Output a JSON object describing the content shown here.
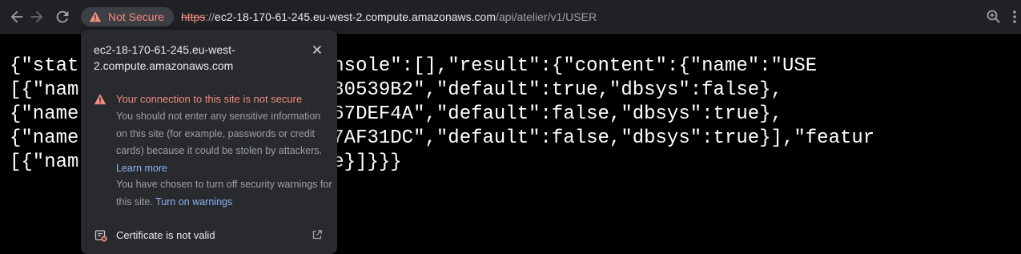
{
  "toolbar": {
    "security_chip_label": "Not Secure",
    "url": {
      "scheme": "https",
      "separator": "://",
      "host": "ec2-18-170-61-245.eu-west-2.compute.amazonaws.com",
      "path": "/api/atelier/v1/USER"
    },
    "icons": {
      "back": "arrow-left-icon",
      "forward": "arrow-right-icon",
      "reload": "reload-icon",
      "security": "warning-triangle-icon",
      "zoom": "zoom-icon",
      "menu": "more-vert-icon"
    }
  },
  "json_body": {
    "lines": [
      "{\"stat        mmary\":\"\"},\"console\":[],\"result\":{\"content\":{\"name\":\"USE",
      "[{\"nam                5F316380539B2\",\"default\":true,\"dbsys\":false},",
      "{\"name              :\"5F22B167DEF4A\",\"default\":false,\"dbsys\":true},",
      "{\"name              :\"5F31637AF31DC\",\"default\":false,\"dbsys\":true}],\"featur",
      "[{\"nam              ed\":false}]}}}"
    ]
  },
  "popup": {
    "host": "ec2-18-170-61-245.eu-west-2.compute.amazonaws.com",
    "security_title": "Your connection to this site is not secure",
    "security_description": "You should not enter any sensitive information on this site (for example, passwords or credit cards) because it could be stolen by attackers.",
    "learn_more_link": "Learn more",
    "warnings_note": "You have chosen to turn off security warnings for this site.",
    "turn_on_warnings_link": "Turn on warnings",
    "certificate_label": "Certificate is not valid"
  },
  "colors": {
    "toolbar_bg": "#202124",
    "popup_bg": "#292a2d",
    "danger": "#f28b82",
    "link": "#8ab4f8",
    "muted_text": "#9aa0a6",
    "text": "#e8eaed"
  }
}
